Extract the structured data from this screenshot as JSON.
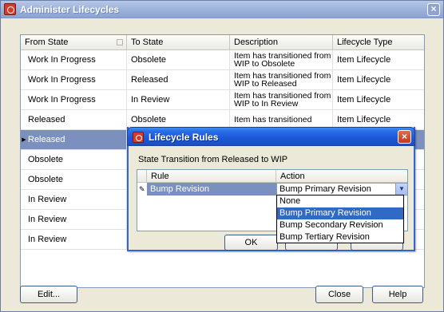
{
  "window": {
    "title": "Administer Lifecycles",
    "close_glyph": "×"
  },
  "grid": {
    "columns": [
      "From State",
      "To State",
      "Description",
      "Lifecycle Type"
    ],
    "rows": [
      {
        "from": "Work In Progress",
        "to": "Obsolete",
        "description": "Item has transitioned from WIP to Obsolete",
        "type": "Item Lifecycle",
        "selected": false
      },
      {
        "from": "Work In Progress",
        "to": "Released",
        "description": "Item has transitioned from WIP to Released",
        "type": "Item Lifecycle",
        "selected": false
      },
      {
        "from": "Work In Progress",
        "to": "In Review",
        "description": "Item has transitioned from WIP to In Review",
        "type": "Item Lifecycle",
        "selected": false
      },
      {
        "from": "Released",
        "to": "Obsolete",
        "description": "Item has transitioned",
        "type": "Item Lifecycle",
        "selected": false
      },
      {
        "from": "Released",
        "to": "",
        "description": "",
        "type": "",
        "selected": true
      },
      {
        "from": "Obsolete",
        "to": "",
        "description": "",
        "type": "",
        "selected": false
      },
      {
        "from": "Obsolete",
        "to": "",
        "description": "",
        "type": "",
        "selected": false
      },
      {
        "from": "In Review",
        "to": "",
        "description": "",
        "type": "",
        "selected": false
      },
      {
        "from": "In Review",
        "to": "",
        "description": "",
        "type": "",
        "selected": false
      },
      {
        "from": "In Review",
        "to": "",
        "description": "",
        "type": "",
        "selected": false
      }
    ]
  },
  "buttons": {
    "edit": "Edit...",
    "close": "Close",
    "help": "Help"
  },
  "dialog": {
    "title": "Lifecycle Rules",
    "close_glyph": "×",
    "transition_label": "State Transition from Released to WIP",
    "columns": [
      "Rule",
      "Action"
    ],
    "rule_value": "Bump Revision",
    "action_value": "Bump Primary Revision",
    "ok": "OK",
    "cancel_partial": "",
    "help_partial": ""
  },
  "dropdown": {
    "options": [
      "None",
      "Bump Primary Revision",
      "Bump Secondary Revision",
      "Bump Tertiary Revision"
    ],
    "highlighted": "Bump Primary Revision"
  },
  "colors": {
    "selection": "#7c90bf",
    "dialog_title": "#1c56d7",
    "dropdown_highlight": "#316ac5"
  }
}
